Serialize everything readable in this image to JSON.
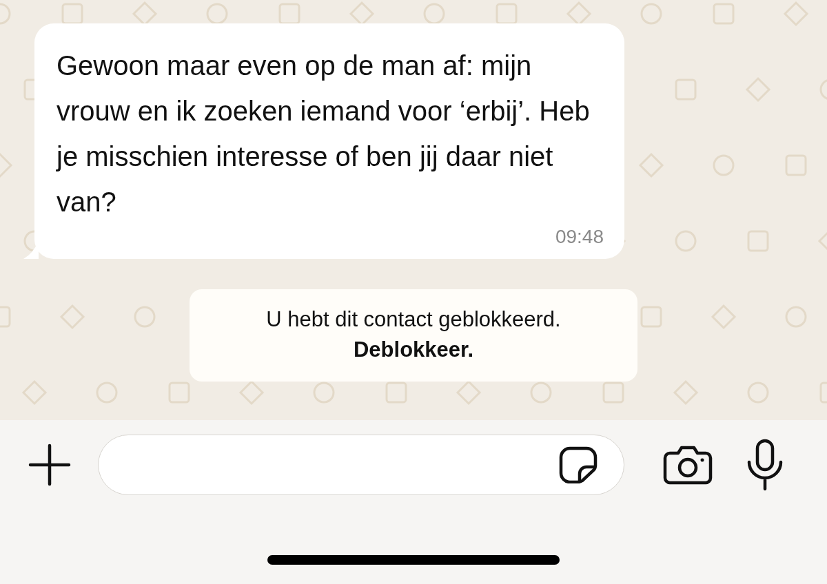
{
  "messages": [
    {
      "kind": "incoming",
      "text": "Gewoon maar even op de man af: mijn vrouw en ik zoeken iemand voor ‘erbij’. Heb je misschien interesse of ben jij daar niet van?",
      "time": "09:48"
    }
  ],
  "notice": {
    "text": "U hebt dit contact geblokkeerd.",
    "action": "Deblokkeer."
  }
}
